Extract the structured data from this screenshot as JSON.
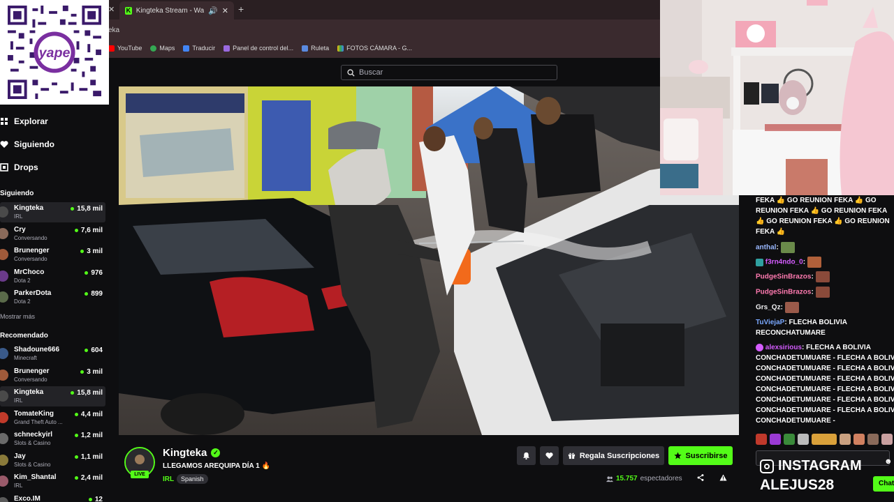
{
  "browser": {
    "tab_title": "Kingteka Stream - Watch L",
    "address_fragment": "eka",
    "bookmarks": [
      "YouTube",
      "Maps",
      "Traducir",
      "Panel de control del...",
      "Ruleta",
      "FOTOS CÁMARA - G..."
    ]
  },
  "qr": {
    "brand": "yape"
  },
  "nav": {
    "links": [
      "Explorar",
      "Siguiendo",
      "Drops"
    ],
    "following_header": "Siguiendo",
    "following": [
      {
        "name": "Kingteka",
        "category": "IRL",
        "viewers": "15,8 mil",
        "avatar_color": "#4a4a4a"
      },
      {
        "name": "Cry",
        "category": "Conversando",
        "viewers": "7,6 mil",
        "avatar_color": "#8a6a5a"
      },
      {
        "name": "Brunenger",
        "category": "Conversando",
        "viewers": "3 mil",
        "avatar_color": "#a05a3a"
      },
      {
        "name": "MrChoco",
        "category": "Dota 2",
        "viewers": "976",
        "avatar_color": "#6a3a8a"
      },
      {
        "name": "ParkerDota",
        "category": "Dota 2",
        "viewers": "899",
        "avatar_color": "#5a6a4a"
      }
    ],
    "show_more": "Mostrar más",
    "recommended_header": "Recomendado",
    "recommended": [
      {
        "name": "Shadoune666",
        "category": "Minecraft",
        "viewers": "604",
        "avatar_color": "#3a5a8a"
      },
      {
        "name": "Brunenger",
        "category": "Conversando",
        "viewers": "3 mil",
        "avatar_color": "#a05a3a"
      },
      {
        "name": "Kingteka",
        "category": "IRL",
        "viewers": "15,8 mil",
        "avatar_color": "#4a4a4a"
      },
      {
        "name": "TomateKing",
        "category": "Grand Theft Auto ...",
        "viewers": "4,4 mil",
        "avatar_color": "#c03a2a"
      },
      {
        "name": "schneckyirl",
        "category": "Slots & Casino",
        "viewers": "1,2 mil",
        "avatar_color": "#6a6a6a"
      },
      {
        "name": "Jay",
        "category": "Slots & Casino",
        "viewers": "1,1 mil",
        "avatar_color": "#8a7a3a"
      },
      {
        "name": "Kim_Shantal",
        "category": "IRL",
        "viewers": "2,4 mil",
        "avatar_color": "#9a5a6a"
      },
      {
        "name": "Exco.IM",
        "category": "",
        "viewers": "12",
        "avatar_color": "#5a5a5a"
      }
    ]
  },
  "search": {
    "placeholder": "Buscar"
  },
  "stream": {
    "channel": "Kingteka",
    "live_label": "LIVE",
    "title": "LLEGAMOS AREQUIPA DÍA 1 🔥",
    "category": "IRL",
    "tag": "Spanish",
    "gift_button": "Regala Suscripciones",
    "subscribe_button": "Suscribirse",
    "viewers_count": "15.757",
    "viewers_label": "espectadores"
  },
  "chat": {
    "lines": [
      "FEKA 👍 GO REUNION FEKA 👍 GO",
      "REUNION FEKA 👍 GO REUNION FEKA",
      "👍 GO REUNION FEKA 👍 GO REUNION",
      "FEKA 👍"
    ],
    "messages": [
      {
        "user": "anthal",
        "color": "#9ab8ff",
        "text": ""
      },
      {
        "user": "f3rn4ndo_0",
        "color": "#d45cff",
        "text": ""
      },
      {
        "user": "PudgeSinBrazos",
        "color": "#ff7ab0",
        "text": ""
      },
      {
        "user": "PudgeSinBrazos",
        "color": "#ff7ab0",
        "text": ""
      },
      {
        "user": "Grs_Qz",
        "color": "#efeff1",
        "text": ""
      },
      {
        "user": "TuViejaP",
        "color": "#7aa8ff",
        "text": "FLECHA BOLIVIA"
      }
    ],
    "tuvieja_line2": "RECONCHATUMARE",
    "alex_user": "alexsirious",
    "alex_color": "#d45cff",
    "alex_lines": [
      "FLECHA A BOLIVIA",
      "CONCHADETUMUARE - FLECHA A BOLIVIA",
      "CONCHADETUMUARE - FLECHA A BOLIVIA",
      "CONCHADETUMUARE - FLECHA A BOLIVIA",
      "CONCHADETUMUARE - FLECHA A BOLIVIA",
      "CONCHADETUMUARE - FLECHA A BOLIVIA",
      "CONCHADETUMUARE - FLECHA A BOLIVIA",
      "CONCHADETUMUARE -"
    ],
    "instagram_label": "INSTAGRAM",
    "instagram_user": "ALEJUS28",
    "chat_button": "Chat"
  },
  "colors": {
    "accent": "#53fc18",
    "bg": "#0e0e10"
  }
}
